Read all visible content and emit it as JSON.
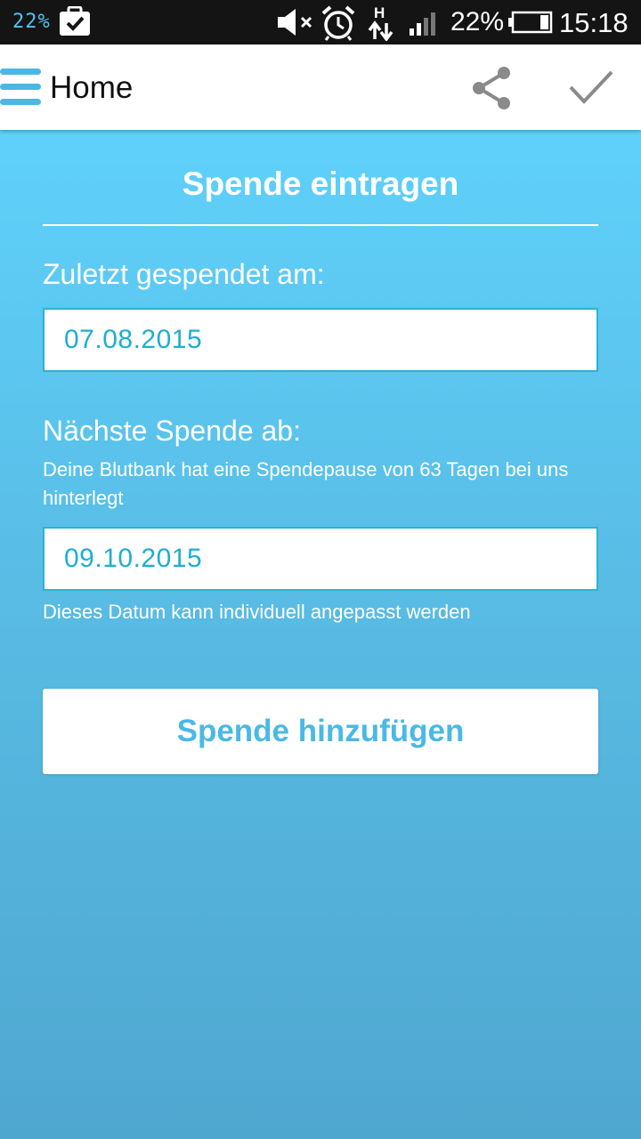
{
  "status_bar": {
    "left_battery_widget": "22%",
    "battery_percent": "22%",
    "time": "15:18",
    "data_indicator": "H",
    "icons": [
      "clipboard-check-icon",
      "mute-icon",
      "alarm-icon",
      "data-transfer-icon",
      "signal-icon",
      "battery-icon"
    ]
  },
  "app_bar": {
    "title": "Home",
    "icons": [
      "menu-icon",
      "share-icon",
      "checkmark-icon"
    ]
  },
  "form": {
    "title": "Spende eintragen",
    "last_donation_label": "Zuletzt gespendet am:",
    "last_donation_value": "07.08.2015",
    "next_donation_label": "Nächste Spende ab:",
    "next_donation_hint": "Deine Blutbank hat eine Spendepause von 63 Tagen bei uns hinterlegt",
    "next_donation_value": "09.10.2015",
    "next_donation_note": "Dieses Datum kann individuell angepasst werden",
    "submit_label": "Spende hinzufügen"
  },
  "colors": {
    "accent": "#4ab9e5",
    "background_top": "#5fd1fb",
    "background_bottom": "#4fa7d0",
    "field_border": "#2bb3d1",
    "field_text": "#1eaed2"
  }
}
